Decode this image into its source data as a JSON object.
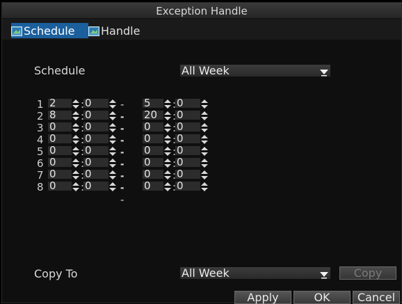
{
  "window": {
    "title": "Exception Handle"
  },
  "tabs": [
    {
      "label": "Schedule",
      "icon": "tab-icon",
      "active": true
    },
    {
      "label": "Handle",
      "icon": "tab-icon",
      "active": false
    }
  ],
  "schedule": {
    "label": "Schedule",
    "value": "All Week"
  },
  "rows": [
    {
      "num": "1",
      "start_h": "2",
      "start_m": "0",
      "end_h": "5",
      "end_m": "0"
    },
    {
      "num": "2",
      "start_h": "8",
      "start_m": "0",
      "end_h": "20",
      "end_m": "0"
    },
    {
      "num": "3",
      "start_h": "0",
      "start_m": "0",
      "end_h": "0",
      "end_m": "0"
    },
    {
      "num": "4",
      "start_h": "0",
      "start_m": "0",
      "end_h": "0",
      "end_m": "0"
    },
    {
      "num": "5",
      "start_h": "0",
      "start_m": "0",
      "end_h": "0",
      "end_m": "0"
    },
    {
      "num": "6",
      "start_h": "0",
      "start_m": "0",
      "end_h": "0",
      "end_m": "0"
    },
    {
      "num": "7",
      "start_h": "0",
      "start_m": "0",
      "end_h": "0",
      "end_m": "0"
    },
    {
      "num": "8",
      "start_h": "0",
      "start_m": "0",
      "end_h": "0",
      "end_m": "0"
    }
  ],
  "separators": {
    "colon": ":",
    "dash": "--"
  },
  "copy_to": {
    "label": "Copy To",
    "value": "All Week",
    "button_label": "Copy"
  },
  "footer": {
    "apply_label": "Apply",
    "ok_label": "OK",
    "cancel_label": "Cancel"
  },
  "colors": {
    "accent": "#1b5f9d",
    "background": "#0f0f0f",
    "field": "#2c2c2c"
  }
}
